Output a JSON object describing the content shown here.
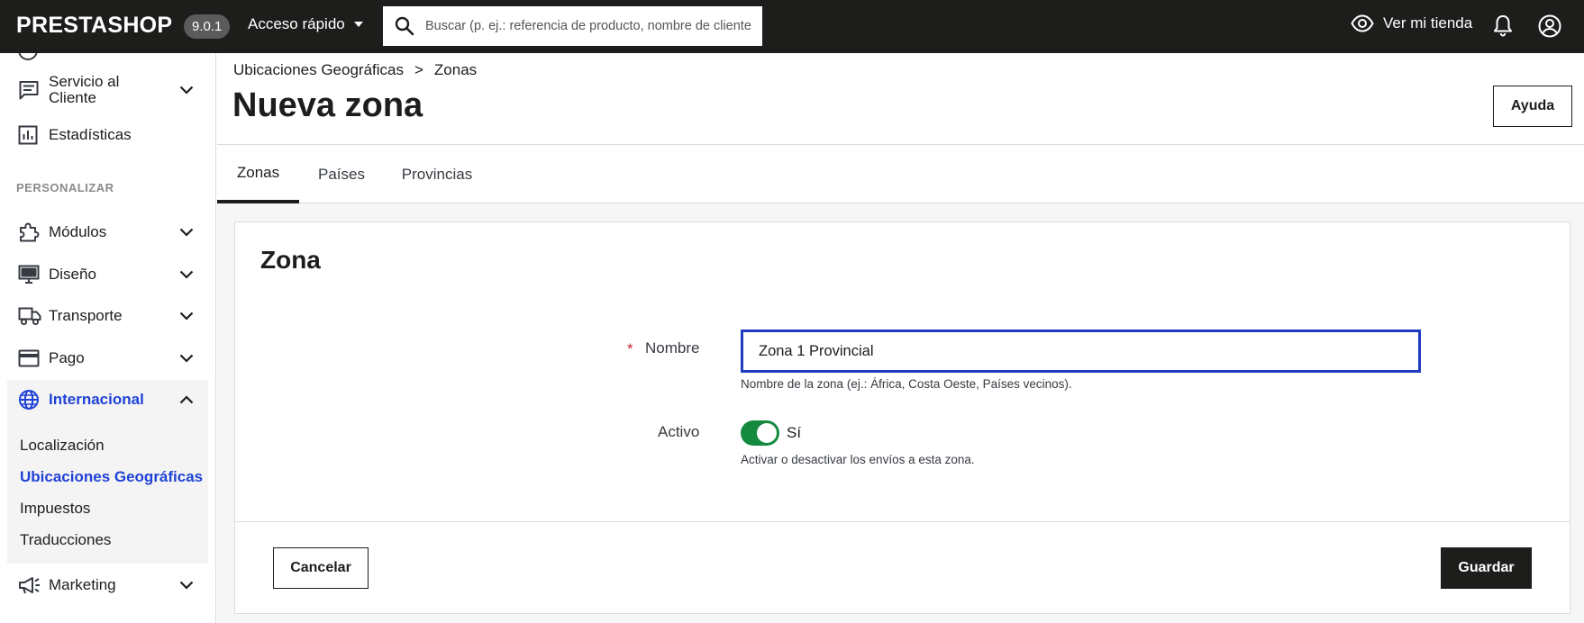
{
  "topbar": {
    "logo": "PRESTASHOP",
    "version": "9.0.1",
    "quick_access_label": "Acceso rápido",
    "search_placeholder": "Buscar (p. ej.: referencia de producto, nombre de cliente",
    "view_shop_label": "Ver mi tienda",
    "icons": [
      "search-icon",
      "eye-icon",
      "bell-icon",
      "account-icon",
      "caret-down-icon"
    ]
  },
  "sidebar": {
    "items_top": [
      {
        "label": "Servicio al Cliente",
        "icon": "chat-icon",
        "expandable": true
      },
      {
        "label": "Estadísticas",
        "icon": "chart-icon",
        "expandable": false
      }
    ],
    "section_label": "PERSONALIZAR",
    "items": [
      {
        "label": "Módulos",
        "icon": "puzzle-icon"
      },
      {
        "label": "Diseño",
        "icon": "monitor-icon"
      },
      {
        "label": "Transporte",
        "icon": "truck-icon"
      },
      {
        "label": "Pago",
        "icon": "card-icon"
      }
    ],
    "active_item": {
      "label": "Internacional",
      "icon": "globe-icon"
    },
    "subitems": [
      {
        "label": "Localización",
        "current": false
      },
      {
        "label": "Ubicaciones Geográficas",
        "current": true
      },
      {
        "label": "Impuestos",
        "current": false
      },
      {
        "label": "Traducciones",
        "current": false
      }
    ],
    "bottom_item": {
      "label": "Marketing",
      "icon": "megaphone-icon"
    }
  },
  "header": {
    "breadcrumb": [
      "Ubicaciones Geográficas",
      ">",
      "Zonas"
    ],
    "title": "Nueva zona",
    "help_label": "Ayuda"
  },
  "tabs": [
    {
      "label": "Zonas",
      "active": true
    },
    {
      "label": "Países",
      "active": false
    },
    {
      "label": "Provincias",
      "active": false
    }
  ],
  "form": {
    "card_title": "Zona",
    "required_mark": "*",
    "name_label": "Nombre",
    "name_value": "Zona 1 Provincial",
    "name_help": "Nombre de la zona (ej.: África, Costa Oeste, Países vecinos).",
    "active_label": "Activo",
    "active_value": "Sí",
    "active_on": true,
    "active_help": "Activar o desactivar los envíos a esta zona.",
    "cancel_label": "Cancelar",
    "save_label": "Guardar"
  },
  "colors": {
    "topbar_bg": "#1d1d1b",
    "accent_blue": "#2042d6",
    "switch_green": "#138a3e",
    "required_red": "#c8202c"
  }
}
